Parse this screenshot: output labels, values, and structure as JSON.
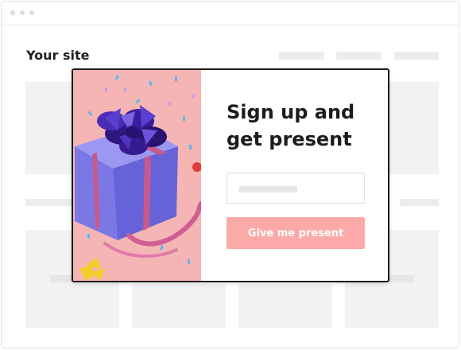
{
  "window": {
    "controls": [
      "dot",
      "dot",
      "dot"
    ]
  },
  "site": {
    "title": "Your site"
  },
  "popup": {
    "title": "Sign up and\nget present",
    "email_placeholder": "",
    "cta_label": "Give me present",
    "image_icon": "gift-box-icon"
  },
  "colors": {
    "cta_background": "#fcaaa9",
    "image_background": "#f5b5b4",
    "gift_box": "#7b78e6",
    "bow": "#3b1c9e",
    "ribbon": "#d05d94",
    "popup_border": "#1b1b1b"
  }
}
